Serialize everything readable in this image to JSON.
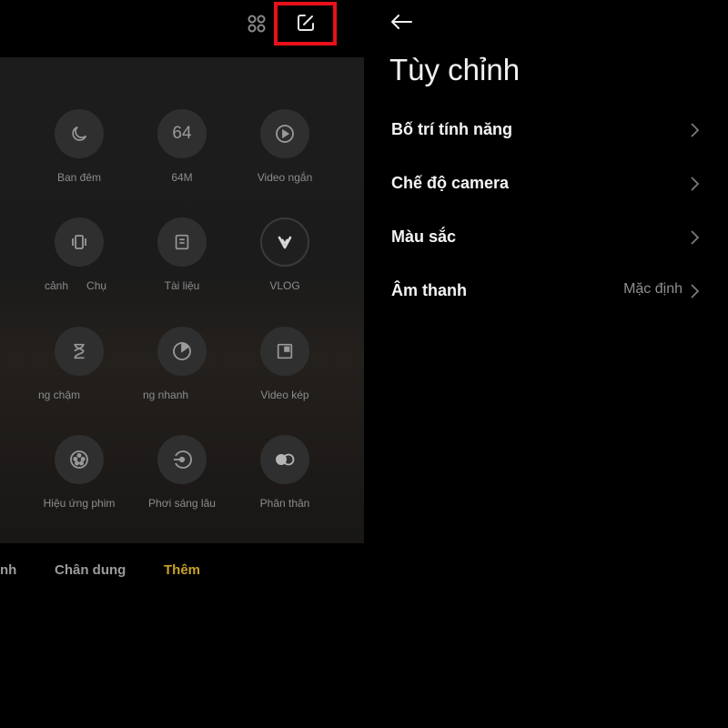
{
  "camera": {
    "modes": [
      {
        "icon": "moon-icon",
        "label": "Ban đêm"
      },
      {
        "icon": "64m-icon",
        "glyph": "64",
        "label": "64M"
      },
      {
        "icon": "play-icon",
        "label": "Video ngắn"
      },
      {
        "icon": "panorama-vibrate-icon",
        "label": "cảnh      Chụ"
      },
      {
        "icon": "document-icon",
        "label": "Tài liệu"
      },
      {
        "icon": "vlog-icon",
        "label": "VLOG"
      },
      {
        "icon": "hourglass-icon",
        "label": "ng chậm"
      },
      {
        "icon": "timer-icon",
        "label": "ng nhanh"
      },
      {
        "icon": "dual-video-icon",
        "label": "Video kép"
      },
      {
        "icon": "film-reel-icon",
        "label": "Hiệu ứng phim"
      },
      {
        "icon": "long-exposure-icon",
        "label": "Phơi sáng lâu"
      },
      {
        "icon": "clone-icon",
        "label": "Phân thân"
      }
    ],
    "tabs": {
      "partial": "nh",
      "portrait": "Chân dung",
      "more": "Thêm"
    }
  },
  "settings": {
    "title": "Tùy chỉnh",
    "rows": [
      {
        "label": "Bố trí tính năng",
        "value": ""
      },
      {
        "label": "Chế độ camera",
        "value": ""
      },
      {
        "label": "Màu sắc",
        "value": ""
      },
      {
        "label": "Âm thanh",
        "value": "Mặc định"
      }
    ]
  },
  "colors": {
    "highlight": "#e8101a",
    "active_tab": "#c9a227"
  }
}
